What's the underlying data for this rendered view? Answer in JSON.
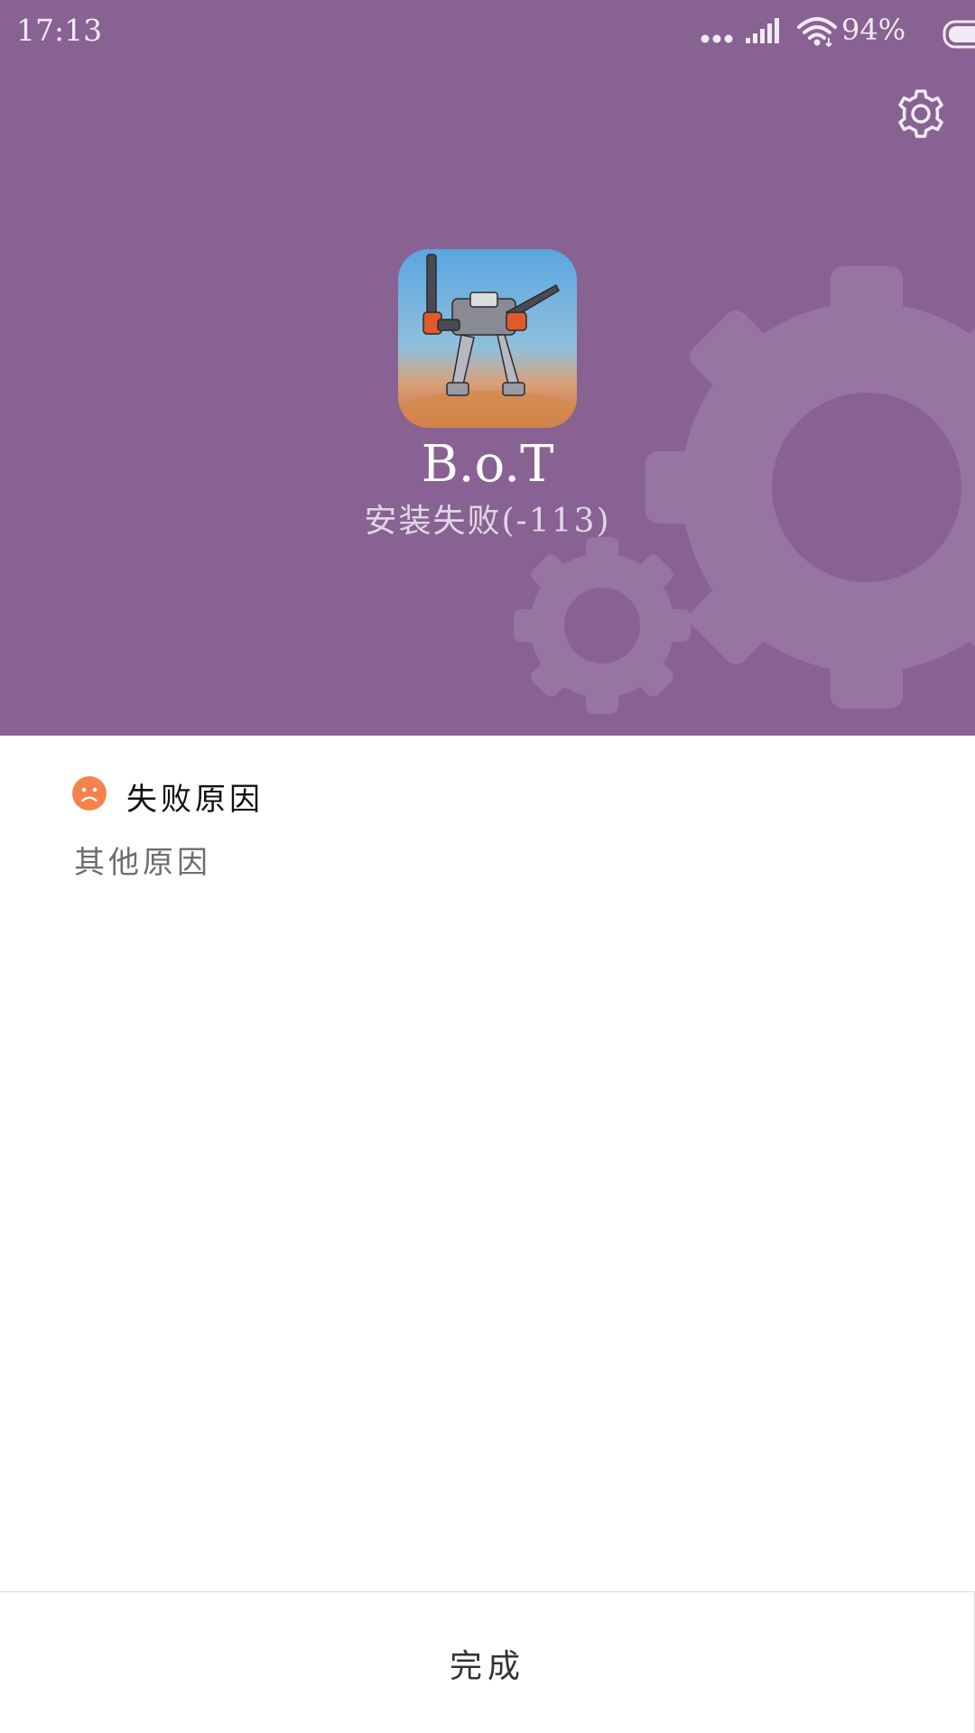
{
  "status_bar": {
    "time": "17:13",
    "battery_percent": "94%",
    "battery_level": 0.94,
    "icons": [
      "more-dots-icon",
      "cellular-signal-icon",
      "wifi-icon",
      "battery-icon"
    ]
  },
  "header": {
    "background_color": "#886292",
    "settings_icon": "gear-icon",
    "app": {
      "name": "B.o.T",
      "status": "安装失败(-113)",
      "icon": "app-icon-mech-robot"
    }
  },
  "failure": {
    "icon": "sad-face-icon",
    "icon_color": "#f5824a",
    "title": "失败原因",
    "reason": "其他原因"
  },
  "footer": {
    "done_label": "完成"
  }
}
